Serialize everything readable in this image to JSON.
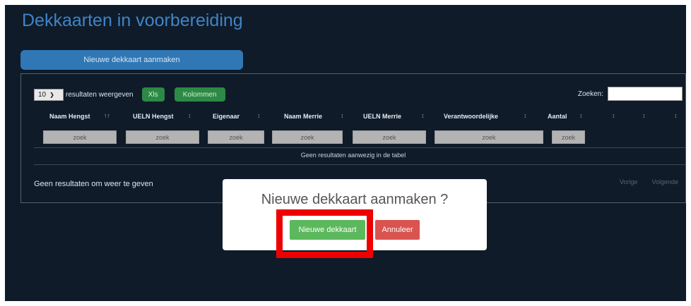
{
  "page": {
    "title": "Dekkaarten in voorbereiding",
    "new_button": "Nieuwe dekkaart aanmaken"
  },
  "table": {
    "length_value": "10",
    "length_label": "resultaten weergeven",
    "xls_button": "Xls",
    "columns_button": "Kolommen",
    "search_label": "Zoeken:",
    "columns": [
      "Naam Hengst",
      "UELN Hengst",
      "Eigenaar",
      "Naam Merrie",
      "UELN Merrie",
      "Verantwoordelijke",
      "Aantal",
      "",
      "",
      ""
    ],
    "filter_placeholder": "zoek",
    "empty_message": "Geen resultaten aanwezig in de tabel",
    "info": "Geen resultaten om weer te geven",
    "prev": "Vorige",
    "next": "Volgende"
  },
  "modal": {
    "title": "Nieuwe dekkaart aanmaken ?",
    "confirm": "Nieuwe dekkaart",
    "cancel": "Annuleer"
  },
  "icons": {
    "sort_asc": "sort-ascending-icon",
    "sort_both": "sort-both-icon",
    "dropdown": "chevron-down-icon"
  },
  "colors": {
    "background": "#0f1b29",
    "accent": "#3077b5",
    "success": "#5cb85c",
    "danger": "#d9534f",
    "highlight": "#ee0000"
  }
}
